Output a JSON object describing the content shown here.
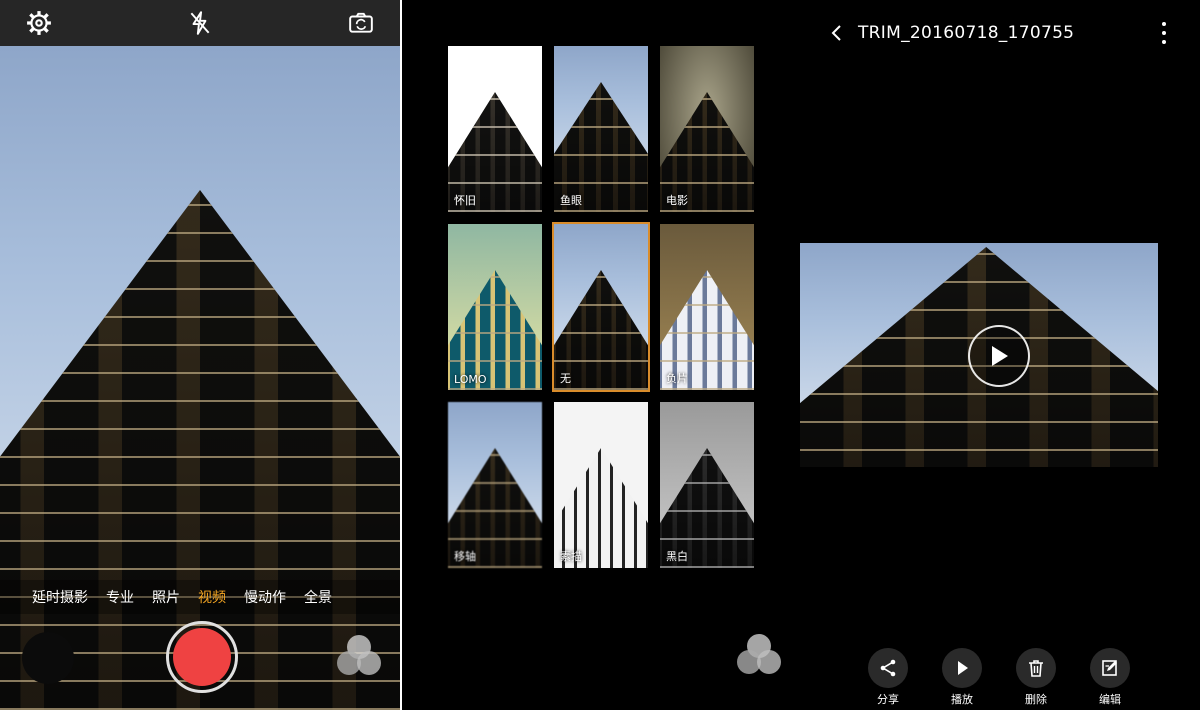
{
  "camera": {
    "icons": {
      "settings": "gear-icon",
      "flash": "flash-off-icon",
      "switch": "camera-switch-icon"
    },
    "modes": [
      "延时摄影",
      "专业",
      "照片",
      "视频",
      "慢动作",
      "全景"
    ],
    "active_mode": "视频",
    "accent": "#f5a623",
    "record_color": "#ef4242"
  },
  "filters": {
    "items": [
      {
        "label": "怀旧"
      },
      {
        "label": "鱼眼"
      },
      {
        "label": "电影"
      },
      {
        "label": "LOMO"
      },
      {
        "label": "无"
      },
      {
        "label": "负片"
      },
      {
        "label": "移轴"
      },
      {
        "label": "素描"
      },
      {
        "label": "黑白"
      }
    ],
    "selected": "无",
    "selected_color": "#d98c2b"
  },
  "gallery": {
    "title": "TRIM_20160718_170755",
    "actions": [
      {
        "label": "分享",
        "icon": "share-icon"
      },
      {
        "label": "播放",
        "icon": "play-icon"
      },
      {
        "label": "删除",
        "icon": "trash-icon"
      },
      {
        "label": "编辑",
        "icon": "edit-icon"
      }
    ]
  }
}
